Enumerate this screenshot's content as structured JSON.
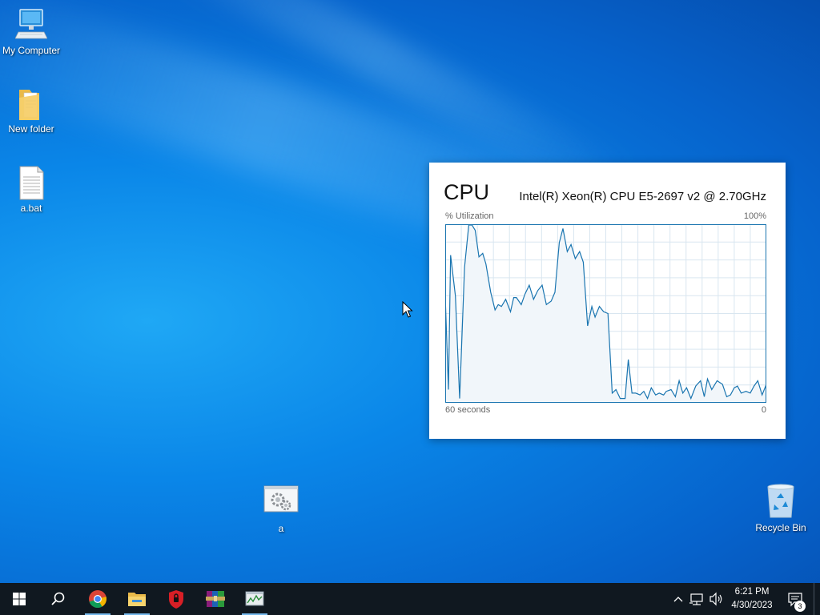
{
  "desktop": {
    "icons": [
      {
        "label": "My Computer",
        "icon": "computer-icon"
      },
      {
        "label": "New folder",
        "icon": "folder-icon"
      },
      {
        "label": "a.bat",
        "icon": "batch-file-icon"
      },
      {
        "label": "a",
        "icon": "settings-shortcut-icon"
      },
      {
        "label": "Recycle Bin",
        "icon": "recycle-bin-icon"
      }
    ]
  },
  "cpu_widget": {
    "title": "CPU",
    "model": "Intel(R) Xeon(R) CPU E5-2697 v2 @ 2.70GHz",
    "utilization_label": "% Utilization",
    "max_label": "100%",
    "x_left_label": "60 seconds",
    "x_right_label": "0",
    "line_color": "#1a75b0",
    "fill_color": "#f1f6fa",
    "grid_color": "#d9e6f0"
  },
  "chart_data": {
    "type": "area",
    "title": "CPU",
    "ylabel": "% Utilization",
    "ylim": [
      0,
      100
    ],
    "xlim": [
      60,
      0
    ],
    "grid": true,
    "series": [
      {
        "x": [
          60,
          59.4,
          59,
          58.1,
          57.3,
          56.4,
          55.6,
          55,
          54.4,
          53.7,
          53,
          52.4,
          51.5,
          50.7,
          50.1,
          49.5,
          48.7,
          47.8,
          47.2,
          46.7,
          45.8,
          45.1,
          44.3,
          43.5,
          42.7,
          41.9,
          41.1,
          40.2,
          39.5,
          38.7,
          38,
          37.2,
          36.5,
          35.7,
          34.9,
          34.2,
          33.4,
          32.6,
          32,
          31.2,
          30.4,
          29.6,
          28.8,
          28.1,
          27.3,
          26.4,
          25.8,
          25.1,
          24.4,
          23.6,
          22.9,
          22.2,
          21.5,
          20.7,
          20,
          19.2,
          18.7,
          17.8,
          17,
          16.3,
          15.6,
          14.9,
          14.1,
          13.2,
          12.3,
          11.6,
          11,
          10.2,
          9.2,
          8.2,
          7.4,
          6.7,
          6,
          5.4,
          4.7,
          3.8,
          3,
          2.3,
          1.6,
          0.8,
          0
        ],
        "y": [
          60,
          7,
          83,
          60,
          2,
          76,
          100,
          100,
          97,
          82,
          84,
          78,
          62,
          52,
          55,
          54,
          58,
          51,
          59,
          59,
          55,
          61,
          66,
          58,
          63,
          66,
          55,
          57,
          62,
          90,
          98,
          85,
          89,
          81,
          85,
          79,
          43,
          54,
          48,
          54,
          51,
          50,
          5,
          7,
          2,
          2,
          24,
          5,
          5,
          4,
          6,
          2,
          8,
          4,
          5,
          4,
          6,
          7,
          3,
          12,
          5,
          8,
          2,
          9,
          12,
          3,
          13,
          7,
          12,
          10,
          3,
          4,
          8,
          9,
          5,
          6,
          5,
          9,
          12,
          4,
          10
        ]
      }
    ]
  },
  "taskbar": {
    "apps": [
      {
        "name": "start-button",
        "icon": "windows-logo-icon"
      },
      {
        "name": "search-button",
        "icon": "search-icon"
      },
      {
        "name": "chrome-button",
        "icon": "chrome-icon",
        "active": true
      },
      {
        "name": "file-explorer-button",
        "icon": "folder-icon",
        "active": true
      },
      {
        "name": "security-app-button",
        "icon": "shield-icon"
      },
      {
        "name": "winrar-button",
        "icon": "winrar-icon"
      },
      {
        "name": "task-manager-button",
        "icon": "task-manager-icon",
        "active": true
      }
    ],
    "tray": {
      "time": "6:21 PM",
      "date": "4/30/2023",
      "notification_count": "3"
    }
  }
}
